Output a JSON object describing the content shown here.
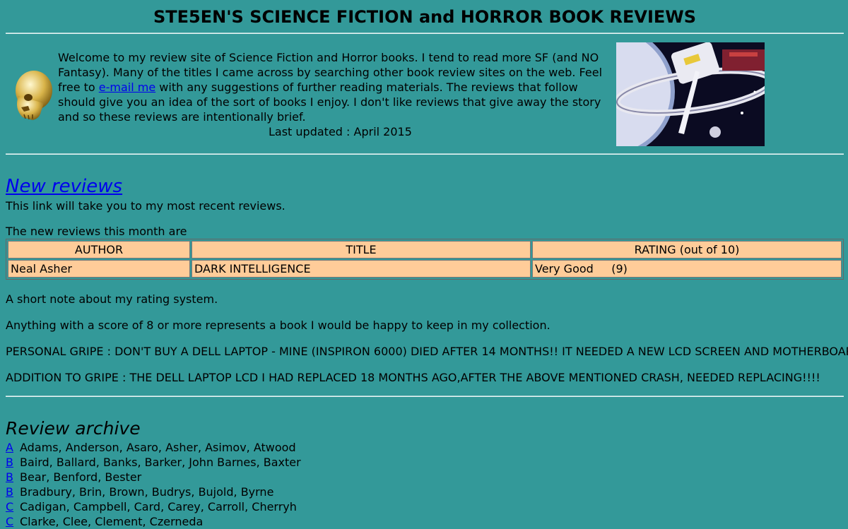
{
  "header": {
    "title": "STE5EN'S SCIENCE FICTION and HORROR BOOK REVIEWS"
  },
  "intro": {
    "text_before_link": "Welcome to my review site of Science Fiction and Horror books. I tend to read more SF (and NO Fantasy). Many of the titles I came across by searching other book review sites on the web. Feel free to ",
    "email_link": "e-mail me",
    "text_after_link": " with any suggestions of further reading materials. The reviews that follow should give you an idea of the sort of books I enjoy. I don't like reviews that give away the story and so these reviews are intentionally brief.",
    "last_updated": "Last updated : April 2015"
  },
  "new_reviews": {
    "link_label": "New reviews",
    "link_desc": "This link will take you to my most recent reviews.",
    "month_intro": "The new reviews this month are",
    "table": {
      "headers": [
        "AUTHOR",
        "TITLE",
        "RATING (out of 10)"
      ],
      "rows": [
        {
          "author": "Neal Asher",
          "title": "DARK INTELLIGENCE",
          "rating": "Very Good     (9)"
        }
      ]
    }
  },
  "notes": {
    "rating_note": "A short note about my rating system.",
    "score_note": "Anything with a score of 8 or more represents a book I would be happy to keep in my collection.",
    "gripe": "PERSONAL GRIPE : DON'T BUY A DELL LAPTOP - MINE (INSPIRON 6000) DIED AFTER 14 MONTHS!! IT NEEDED A NEW LCD SCREEN AND MOTHERBOARD!",
    "gripe_addition": "ADDITION TO GRIPE : THE DELL LAPTOP LCD I HAD REPLACED 18 MONTHS AGO,AFTER THE ABOVE MENTIONED CRASH, NEEDED REPLACING!!!!"
  },
  "archive": {
    "title": "Review archive",
    "rows": [
      {
        "letter": "A",
        "authors": "Adams, Anderson, Asaro, Asher, Asimov, Atwood"
      },
      {
        "letter": "B",
        "authors": "Baird, Ballard, Banks, Barker, John Barnes, Baxter"
      },
      {
        "letter": "B",
        "authors": "Bear, Benford, Bester"
      },
      {
        "letter": "B",
        "authors": "Bradbury, Brin, Brown, Budrys, Bujold, Byrne"
      },
      {
        "letter": "C",
        "authors": "Cadigan, Campbell, Card, Carey, Carroll, Cherryh"
      },
      {
        "letter": "C",
        "authors": "Clarke, Clee, Clement, Czerneda"
      }
    ]
  },
  "colors": {
    "background": "#339999",
    "table_cell": "#ffcc99",
    "link": "#0000ee"
  }
}
